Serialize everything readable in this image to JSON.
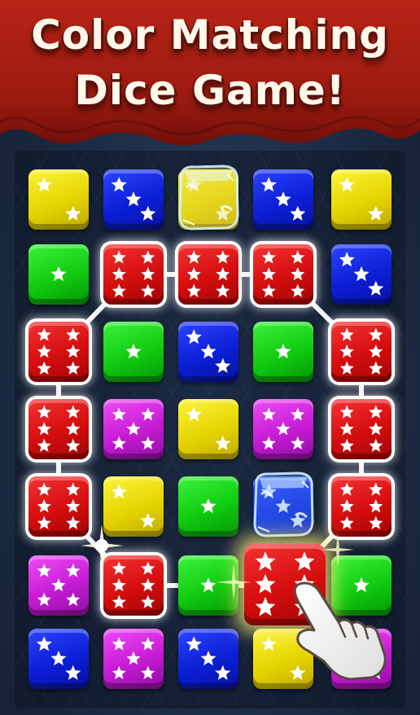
{
  "title": {
    "line1": "Color Matching",
    "line2": "Dice Game!"
  },
  "colors": {
    "yellow": "#e6d400",
    "blue": "#0b1fd6",
    "green": "#10cc10",
    "magenta": "#c61bd4",
    "red": "#d40d0d",
    "banner": "#a41c12",
    "text": "#fff8ea"
  },
  "board": {
    "rows": [
      [
        {
          "color": "yellow",
          "pips": 2
        },
        {
          "color": "blue",
          "pips": 3
        },
        {
          "color": "yellow",
          "pips": 2,
          "frozen": true
        },
        {
          "color": "blue",
          "pips": 3
        },
        {
          "color": "yellow",
          "pips": 2
        }
      ],
      [
        {
          "color": "green",
          "pips": 1
        },
        {
          "color": "red",
          "pips": 6,
          "selected": true
        },
        {
          "color": "red",
          "pips": 6,
          "selected": true
        },
        {
          "color": "red",
          "pips": 6,
          "selected": true
        },
        {
          "color": "blue",
          "pips": 3
        }
      ],
      [
        {
          "color": "red",
          "pips": 6,
          "selected": true
        },
        {
          "color": "green",
          "pips": 1
        },
        {
          "color": "blue",
          "pips": 3
        },
        {
          "color": "green",
          "pips": 1
        },
        {
          "color": "red",
          "pips": 6,
          "selected": true
        }
      ],
      [
        {
          "color": "red",
          "pips": 6,
          "selected": true
        },
        {
          "color": "magenta",
          "pips": 5
        },
        {
          "color": "yellow",
          "pips": 2
        },
        {
          "color": "magenta",
          "pips": 5
        },
        {
          "color": "red",
          "pips": 6,
          "selected": true
        }
      ],
      [
        {
          "color": "red",
          "pips": 6,
          "selected": true
        },
        {
          "color": "yellow",
          "pips": 2
        },
        {
          "color": "green",
          "pips": 1
        },
        {
          "color": "blue",
          "pips": 3,
          "frozen": true
        },
        {
          "color": "red",
          "pips": 6,
          "selected": true
        }
      ],
      [
        {
          "color": "magenta",
          "pips": 5
        },
        {
          "color": "red",
          "pips": 6,
          "selected": true
        },
        {
          "color": "green",
          "pips": 1
        },
        {
          "color": "red",
          "pips": 6,
          "highlighted": true
        },
        {
          "color": "green",
          "pips": 1
        }
      ],
      [
        {
          "color": "blue",
          "pips": 3
        },
        {
          "color": "magenta",
          "pips": 5
        },
        {
          "color": "blue",
          "pips": 3
        },
        {
          "color": "yellow",
          "pips": 2
        },
        {
          "color": "magenta",
          "pips": 5
        }
      ]
    ]
  },
  "icons": {
    "pip": "star-icon",
    "pointer": "pointing-hand-icon",
    "ice": "ice-cube-icon"
  }
}
